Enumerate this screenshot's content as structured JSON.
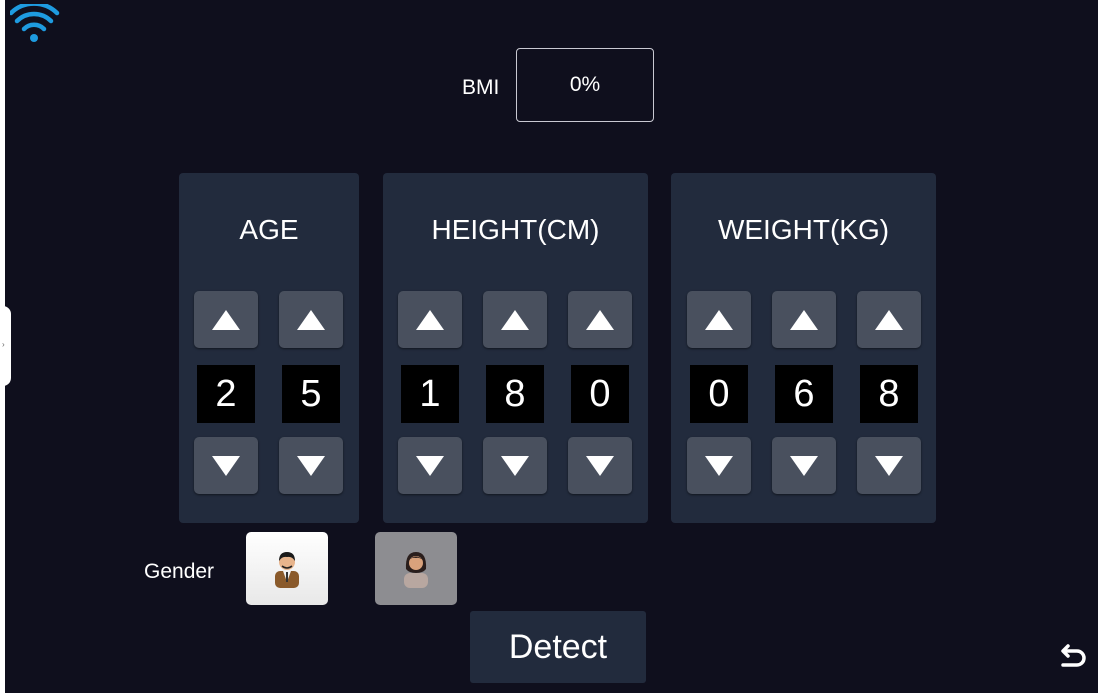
{
  "status": {
    "wifi_icon": "wifi-icon"
  },
  "bmi": {
    "label": "BMI",
    "value": "0%"
  },
  "age": {
    "title": "AGE",
    "digits": [
      "2",
      "5"
    ]
  },
  "height": {
    "title": "HEIGHT(CM)",
    "digits": [
      "1",
      "8",
      "0"
    ]
  },
  "weight": {
    "title": "WEIGHT(KG)",
    "digits": [
      "0",
      "6",
      "8"
    ]
  },
  "gender": {
    "label": "Gender",
    "options": [
      "male-avatar-icon",
      "female-avatar-icon"
    ],
    "selected": "male"
  },
  "actions": {
    "detect_label": "Detect",
    "back_icon": "back-arrow-icon"
  },
  "colors": {
    "background": "#0f0f1d",
    "panel": "#222b3d",
    "button": "#49505e",
    "wifi": "#1e9be0"
  }
}
